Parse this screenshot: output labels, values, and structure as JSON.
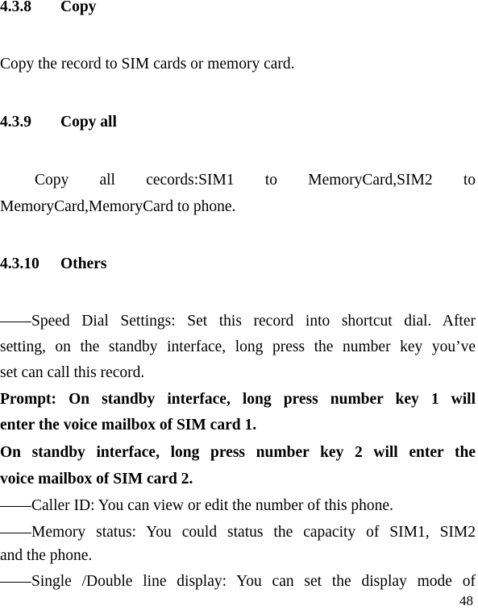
{
  "sections": [
    {
      "number": "4.3.8",
      "title": "Copy",
      "lines": [
        "Copy the record to SIM cards or memory card."
      ]
    },
    {
      "number": "4.3.9",
      "title": "Copy all",
      "lines": [
        "Copy all cecords:SIM1 to MemoryCard,SIM2 to",
        "MemoryCard,MemoryCard to phone."
      ]
    },
    {
      "number": "4.3.10",
      "title": "Others",
      "speed_dial": [
        "——Speed Dial Settings: Set this record into shortcut dial. After",
        "setting, on the standby interface, long press the number key you’ve",
        "set can call this record."
      ],
      "prompt": [
        "Prompt: On standby interface, long press number key 1 will",
        "enter the voice mailbox of SIM card 1."
      ],
      "standby2": [
        "On standby interface, long press number key 2 will enter the",
        "voice mailbox of SIM card 2."
      ],
      "caller_id": [
        "——Caller ID: You can view or edit the number of this phone."
      ],
      "memory_status": [
        "——Memory status: You could status the capacity of SIM1, SIM2",
        "and the phone."
      ],
      "line_display": [
        "——Single /Double line display: You can set the display mode of"
      ]
    }
  ],
  "page_number": "48"
}
